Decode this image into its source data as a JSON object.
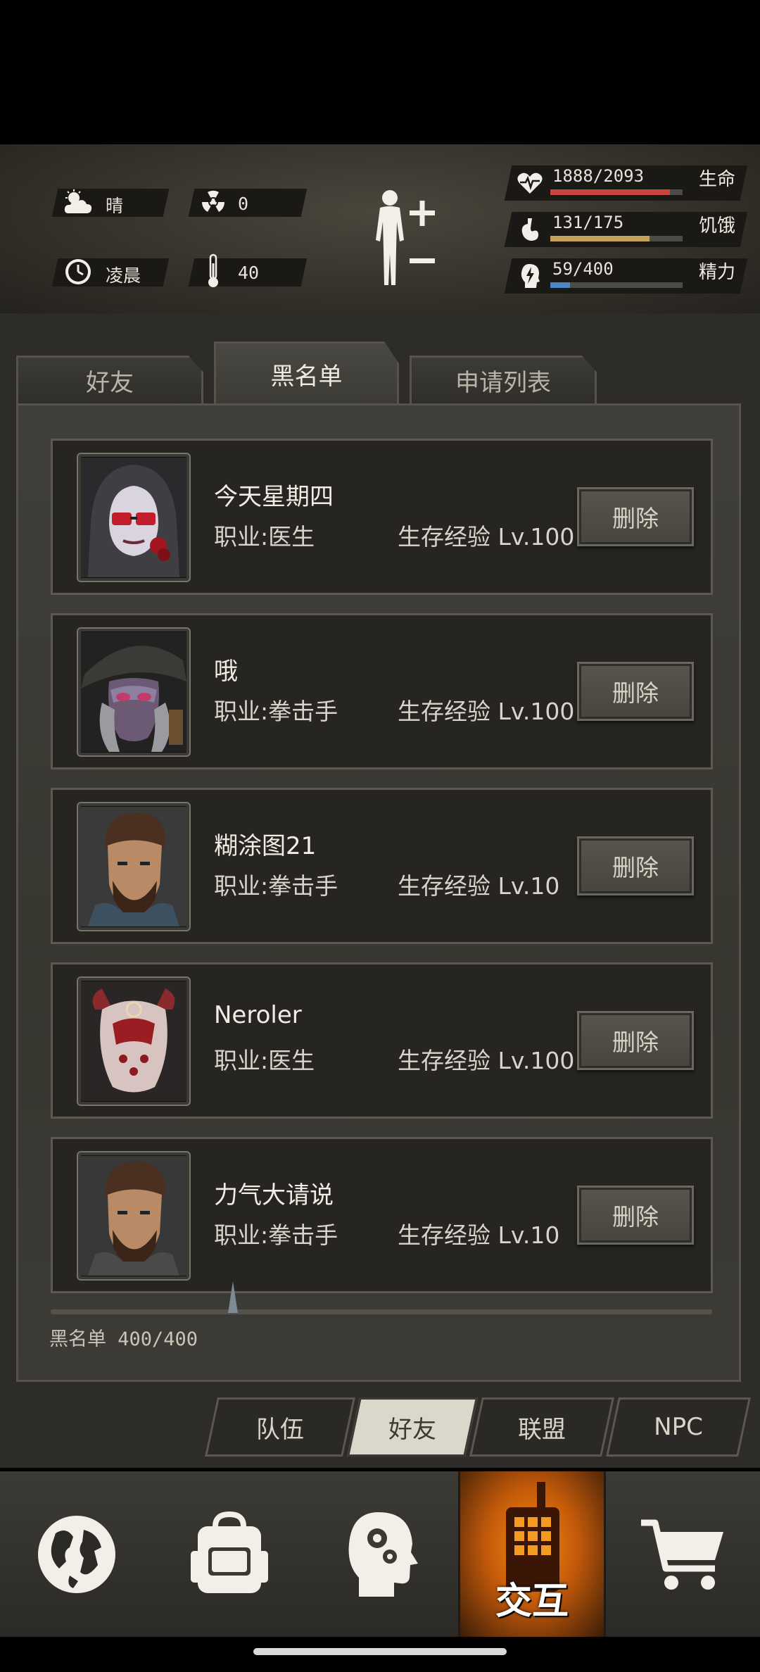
{
  "hud": {
    "weather": "晴",
    "radiation": "0",
    "time_of_day": "凌晨",
    "temperature": "40",
    "stats": [
      {
        "value": "1888/2093",
        "name": "生命",
        "fill": 0.902,
        "color": "#c8463d"
      },
      {
        "value": "131/175",
        "name": "饥饿",
        "fill": 0.749,
        "color": "#c4a15a"
      },
      {
        "value": "59/400",
        "name": "精力",
        "fill": 0.148,
        "color": "#4f87c4"
      }
    ]
  },
  "tabs": [
    {
      "label": "好友",
      "active": false
    },
    {
      "label": "黑名单",
      "active": true
    },
    {
      "label": "申请列表",
      "active": false
    }
  ],
  "blacklist": [
    {
      "name": "今天星期四",
      "job": "职业:医生",
      "exp": "生存经验 Lv.100",
      "delete_label": "删除",
      "avatar": "hooded-doctor"
    },
    {
      "name": "哦",
      "job": "职业:拳击手",
      "exp": "生存经验 Lv.100",
      "delete_label": "删除",
      "avatar": "masked-pirate"
    },
    {
      "name": "糊涂图21",
      "job": "职业:拳击手",
      "exp": "生存经验 Lv.10",
      "delete_label": "删除",
      "avatar": "bearded-man"
    },
    {
      "name": "Neroler",
      "job": "职业:医生",
      "exp": "生存经验 Lv.100",
      "delete_label": "删除",
      "avatar": "creature-skull"
    },
    {
      "name": "力气大请说",
      "job": "职业:拳击手",
      "exp": "生存经验 Lv.10",
      "delete_label": "删除",
      "avatar": "bearded-man"
    }
  ],
  "list_count": "黑名单 400/400",
  "subtabs": [
    {
      "label": "队伍",
      "active": false
    },
    {
      "label": "好友",
      "active": true
    },
    {
      "label": "联盟",
      "active": false
    },
    {
      "label": "NPC",
      "active": false
    }
  ],
  "nav": [
    {
      "icon": "globe-icon",
      "label": ""
    },
    {
      "icon": "backpack-icon",
      "label": ""
    },
    {
      "icon": "skills-head-icon",
      "label": ""
    },
    {
      "icon": "walkie-talkie-icon",
      "label": "交互",
      "active": true
    },
    {
      "icon": "shopping-cart-icon",
      "label": ""
    }
  ]
}
